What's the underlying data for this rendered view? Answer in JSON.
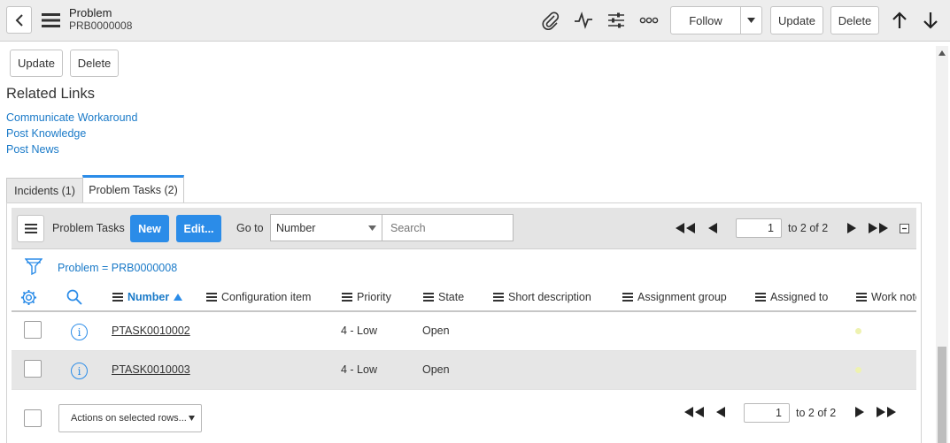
{
  "header": {
    "title": "Problem",
    "number": "PRB0000008",
    "follow_label": "Follow",
    "update_label": "Update",
    "delete_label": "Delete"
  },
  "form_buttons": {
    "update_label": "Update",
    "delete_label": "Delete"
  },
  "related_links": {
    "heading": "Related Links",
    "items": [
      "Communicate Workaround",
      "Post Knowledge",
      "Post News"
    ]
  },
  "tabs": [
    {
      "label": "Incidents (1)",
      "active": false
    },
    {
      "label": "Problem Tasks (2)",
      "active": true
    }
  ],
  "list": {
    "title": "Problem Tasks",
    "new_label": "New",
    "edit_label": "Edit...",
    "goto_label": "Go to",
    "goto_field": "Number",
    "search_placeholder": "Search",
    "page_value": "1",
    "page_total": "to 2 of 2",
    "filter": "Problem = PRB0000008",
    "columns": [
      "Number",
      "Configuration item",
      "Priority",
      "State",
      "Short description",
      "Assignment group",
      "Assigned to",
      "Work notes"
    ],
    "sorted_column": "Number",
    "rows": [
      {
        "number": "PTASK0010002",
        "priority": "4 - Low",
        "state": "Open"
      },
      {
        "number": "PTASK0010003",
        "priority": "4 - Low",
        "state": "Open"
      }
    ],
    "actions_placeholder": "Actions on selected rows...",
    "footer_page_value": "1",
    "footer_page_total": "to 2 of 2"
  },
  "colors": {
    "accent": "#2b8ce8",
    "link": "#1a7ac8",
    "header_bg": "#ededed"
  }
}
